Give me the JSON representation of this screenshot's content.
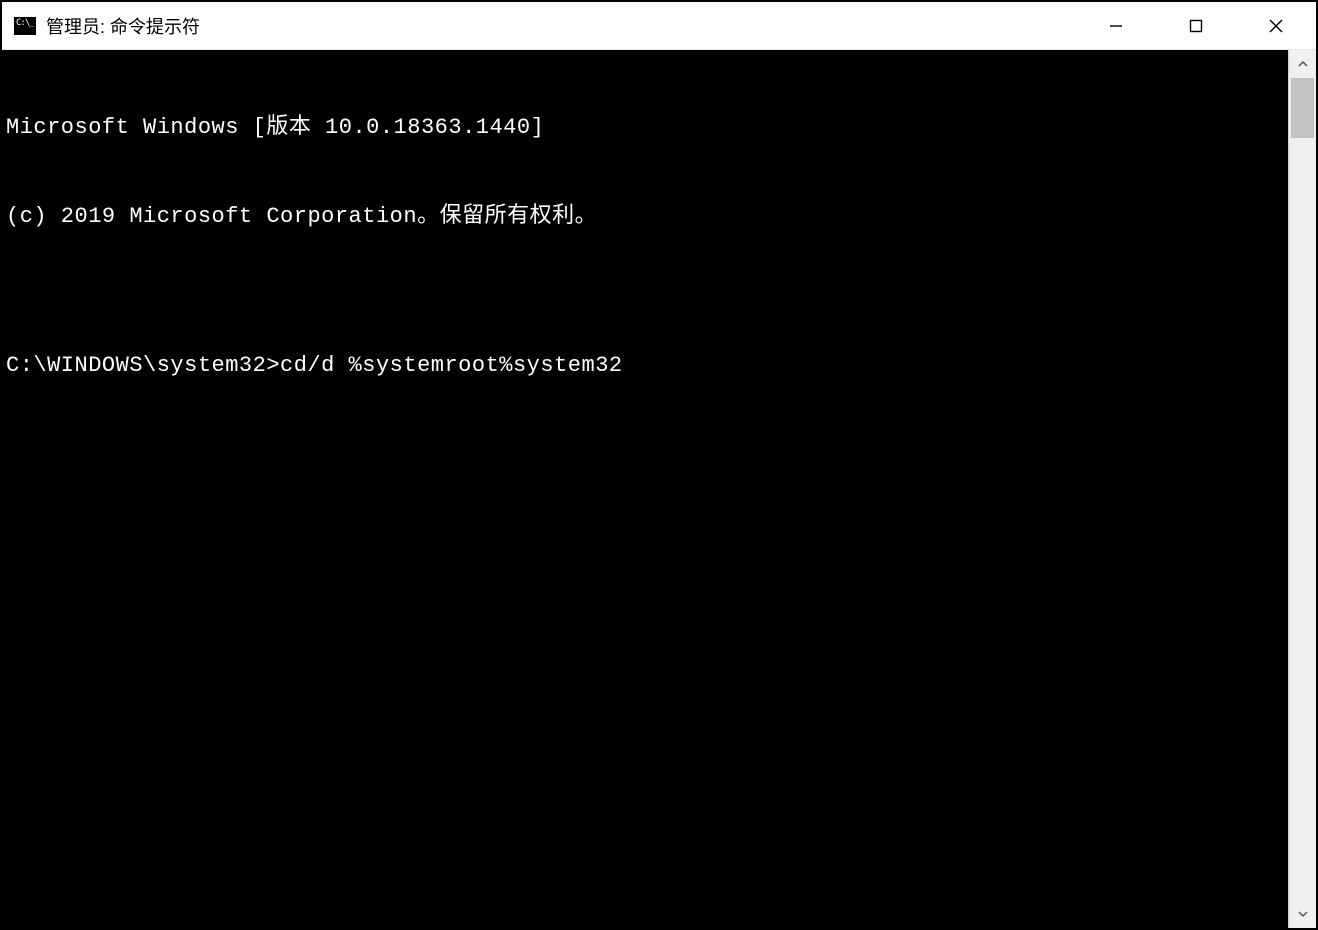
{
  "window": {
    "title": "管理员: 命令提示符"
  },
  "terminal": {
    "line1": "Microsoft Windows [版本 10.0.18363.1440]",
    "line2": "(c) 2019 Microsoft Corporation。保留所有权利。",
    "blank": "",
    "prompt": "C:\\WINDOWS\\system32>",
    "command": "cd/d %systemroot%system32"
  }
}
